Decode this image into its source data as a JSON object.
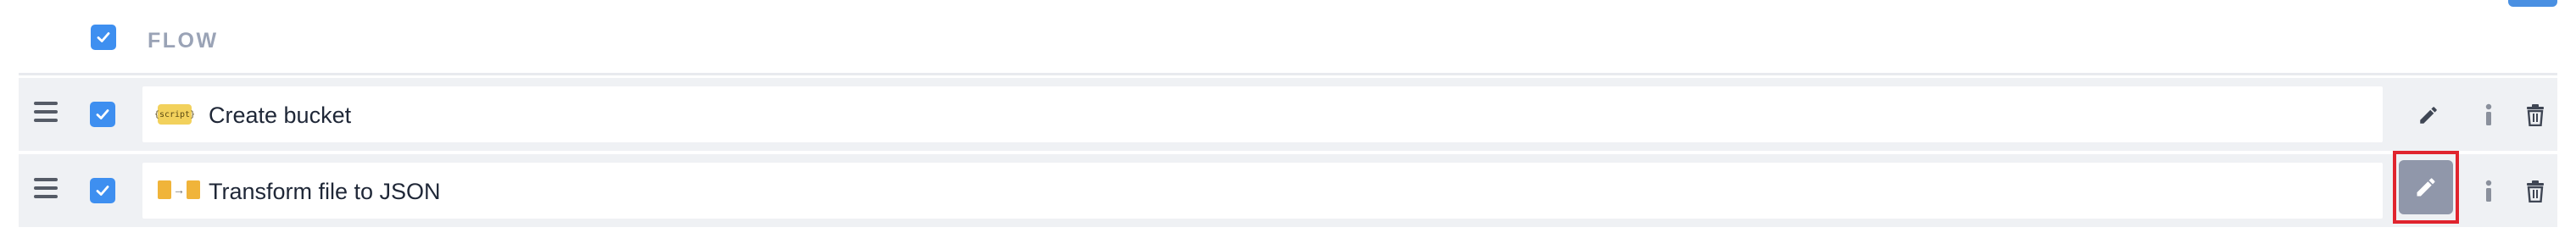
{
  "header": {
    "title": "FLOW",
    "select_all_checked": true
  },
  "rows": [
    {
      "icon": "script-icon",
      "icon_text": "{script}",
      "label": "Create bucket",
      "checked": true,
      "edit_highlighted": false
    },
    {
      "icon": "transform-file-icon",
      "label": "Transform file to JSON",
      "checked": true,
      "edit_highlighted": true
    }
  ],
  "actions": {
    "edit_icon": "pencil-icon",
    "info_icon": "info-icon",
    "delete_icon": "trash-icon"
  },
  "colors": {
    "checkbox": "#3e8ff0",
    "highlight_border": "#e0242e",
    "active_edit_bg": "#9097aa",
    "row_bg": "#eff1f4",
    "header_text": "#9aa3b6"
  }
}
